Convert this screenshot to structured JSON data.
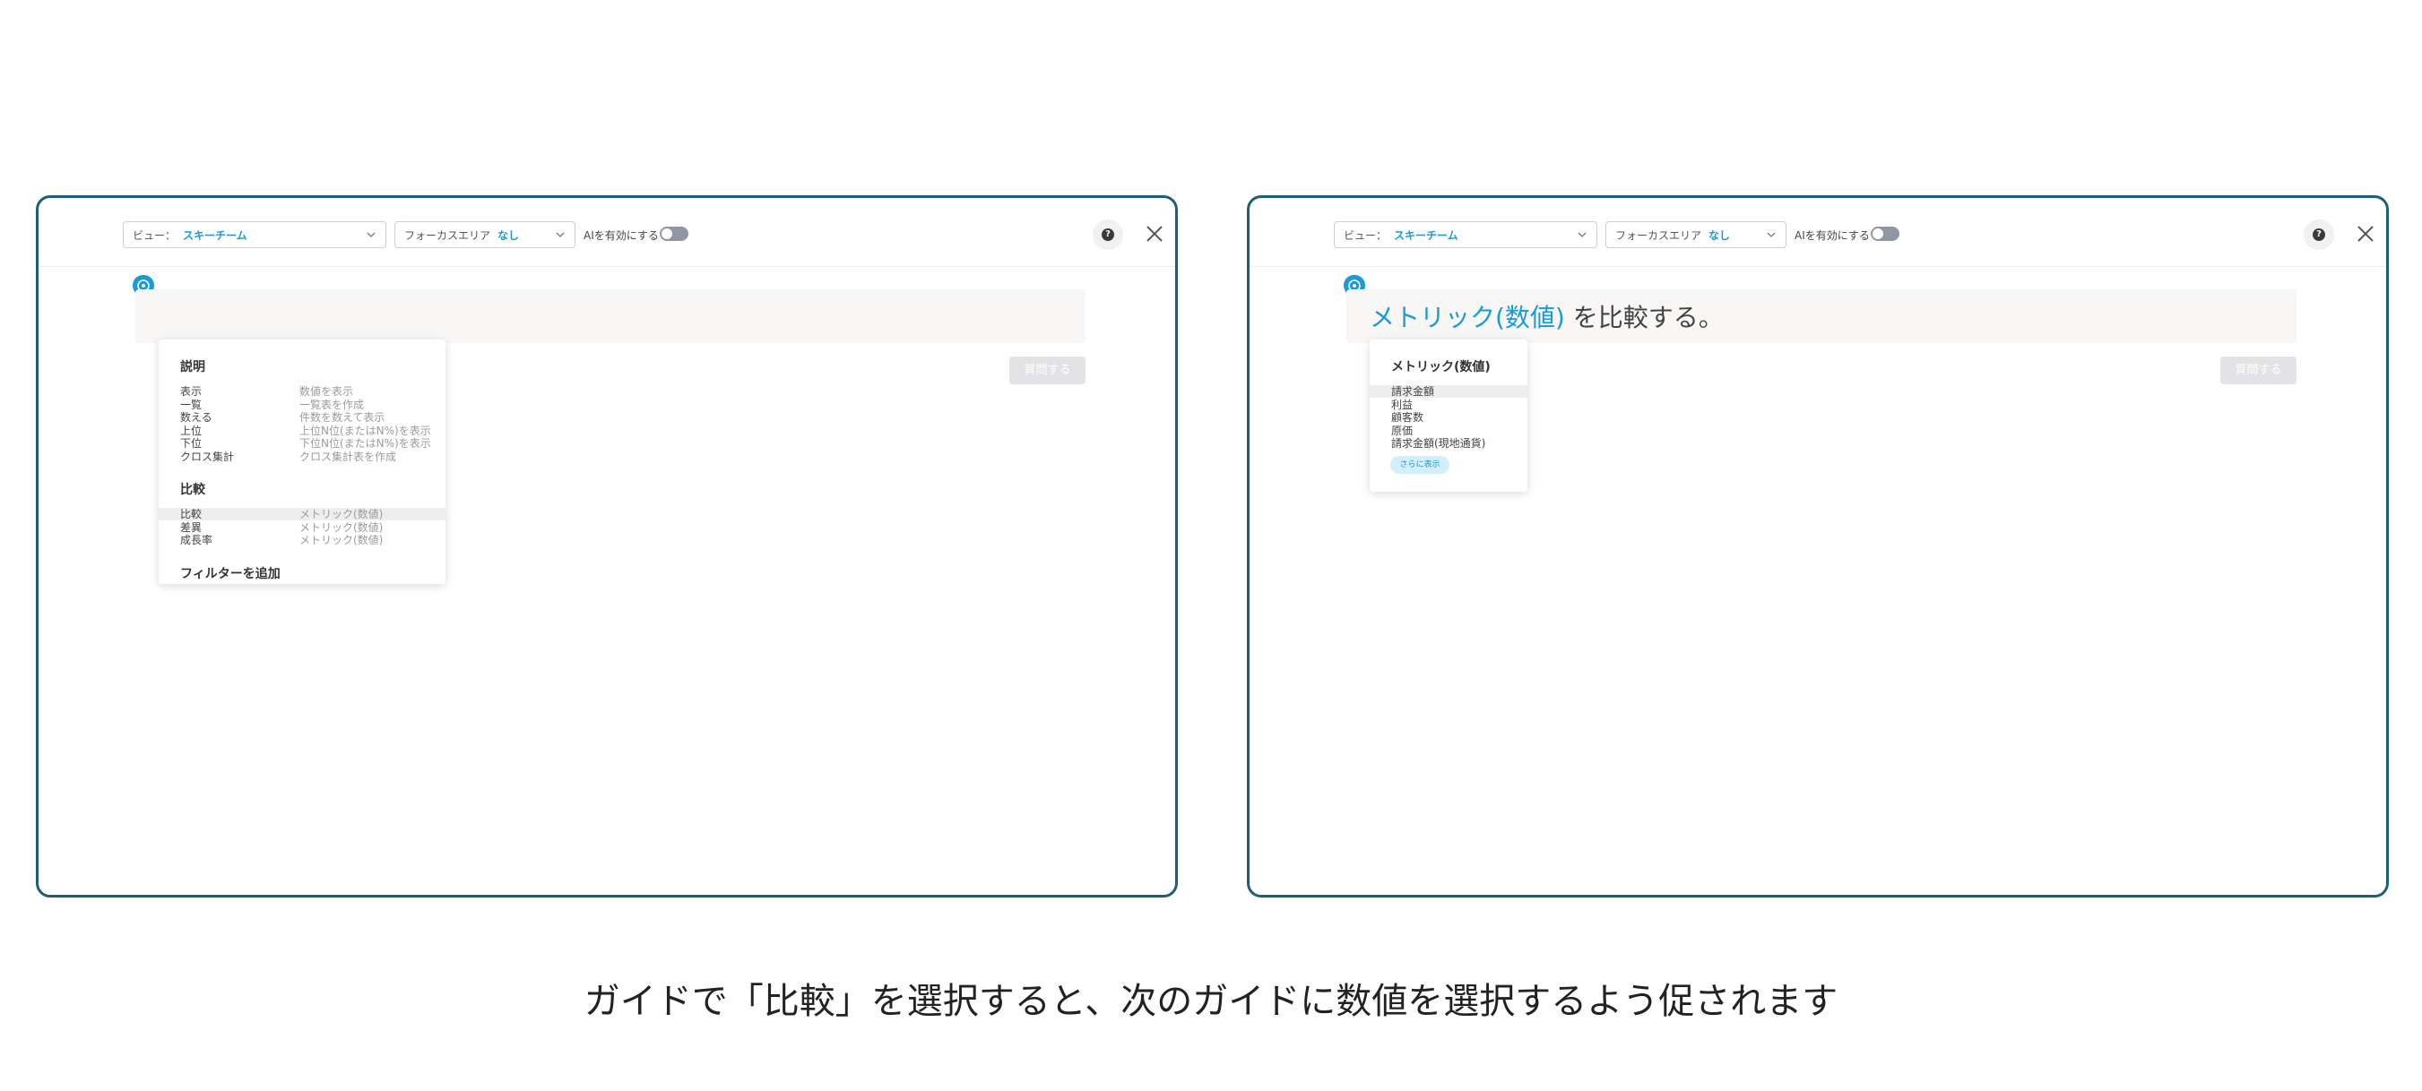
{
  "left": {
    "view_label": "ビュー：",
    "view_value": "スキーチーム",
    "focus_label": "フォーカスエリア",
    "focus_value": "なし",
    "ai_label": "AIを有効にする",
    "submit_label": "質問する",
    "guide": {
      "sections": [
        {
          "title": "説明",
          "items": [
            {
              "label": "表示",
              "desc": "数値を表示"
            },
            {
              "label": "一覧",
              "desc": "一覧表を作成"
            },
            {
              "label": "数える",
              "desc": "件数を数えて表示"
            },
            {
              "label": "上位",
              "desc": "上位N位(またはN%)を表示"
            },
            {
              "label": "下位",
              "desc": "下位N位(またはN%)を表示"
            },
            {
              "label": "クロス集計",
              "desc": "クロス集計表を作成"
            }
          ]
        },
        {
          "title": "比較",
          "items": [
            {
              "label": "比較",
              "desc": "メトリック(数値)",
              "highlighted": true
            },
            {
              "label": "差異",
              "desc": "メトリック(数値)"
            },
            {
              "label": "成長率",
              "desc": "メトリック(数値)"
            }
          ]
        },
        {
          "title": "フィルターを追加",
          "items": []
        }
      ]
    }
  },
  "right": {
    "view_label": "ビュー：",
    "view_value": "スキーチーム",
    "focus_label": "フォーカスエリア",
    "focus_value": "なし",
    "ai_label": "AIを有効にする",
    "submit_label": "質問する",
    "query_metric": "メトリック(数値)",
    "query_rest": " を比較する。",
    "metric_dropdown": {
      "title": "メトリック(数値)",
      "items": [
        "請求金額",
        "利益",
        "顧客数",
        "原価",
        "請求金額(現地通貨)"
      ],
      "more_label": "さらに表示"
    }
  },
  "caption": "ガイドで「比較」を選択すると、次のガイドに数値を選択するよう促されます",
  "colors": {
    "frame_border": "#1f5d79",
    "accent": "#1a9ad6",
    "toggle_off": "#9096a3"
  },
  "icons": [
    "chevron-down-icon",
    "toggle-switch",
    "help-icon",
    "close-icon",
    "location-pin-icon"
  ]
}
